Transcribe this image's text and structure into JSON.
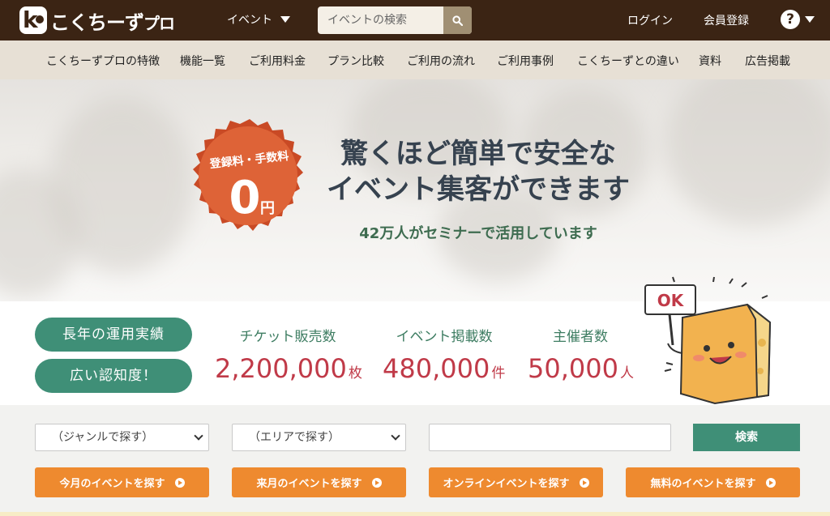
{
  "header": {
    "logo_text": "こくちーず",
    "logo_suffix": "プロ",
    "event_menu_label": "イベント",
    "search_placeholder": "イベントの検索",
    "login_label": "ログイン",
    "register_label": "会員登録",
    "help_icon": "?"
  },
  "subnav": {
    "items": [
      "こくちーずプロの特徴",
      "機能一覧",
      "ご利用料金",
      "プラン比較",
      "ご利用の流れ",
      "ご利用事例",
      "こくちーずとの違い",
      "資料",
      "広告掲載"
    ]
  },
  "hero": {
    "badge_line1": "登録料・手数料",
    "badge_number": "0",
    "badge_unit": "円",
    "title_line1": "驚くほど簡単で安全な",
    "title_line2": "イベント集客ができます",
    "subtitle": "42万人がセミナーで活用しています",
    "mascot_sign": "OK"
  },
  "stats": {
    "pills": [
      "長年の運用実績",
      "広い認知度！"
    ],
    "items": [
      {
        "label": "チケット販売数",
        "value": "2,200,000",
        "unit": "枚"
      },
      {
        "label": "イベント掲載数",
        "value": "480,000",
        "unit": "件"
      },
      {
        "label": "主催者数",
        "value": "50,000",
        "unit": "人"
      }
    ]
  },
  "search": {
    "genre_select": "（ジャンルで探す）",
    "area_select": "（エリアで探す）",
    "keyword_value": "",
    "submit_label": "検索",
    "quick_buttons": [
      "今月のイベントを探す",
      "来月のイベントを探す",
      "オンラインイベントを探す",
      "無料のイベントを探す"
    ]
  },
  "colors": {
    "header_bg": "#3b2414",
    "subnav_bg": "#e7e0d5",
    "accent_green": "#3f8f77",
    "stat_red": "#c03a48",
    "orange": "#ee8a2f",
    "badge_red": "#d9562f"
  }
}
